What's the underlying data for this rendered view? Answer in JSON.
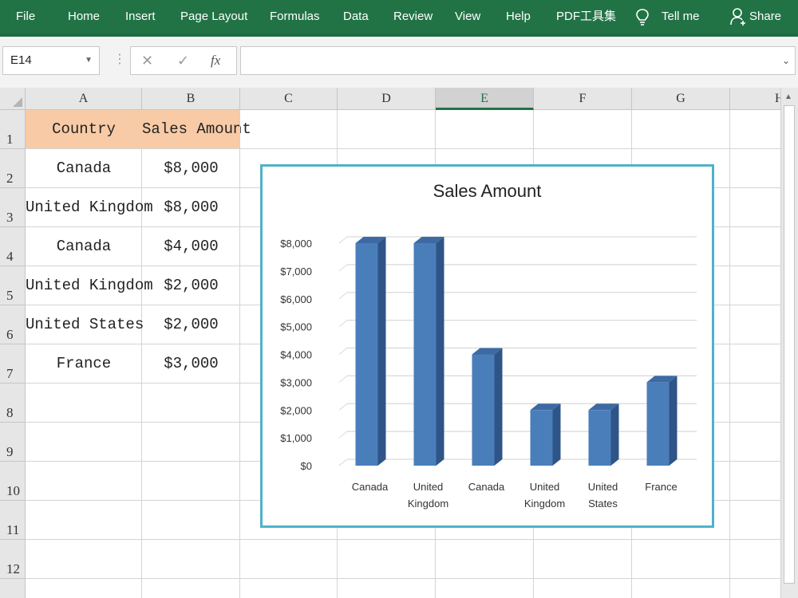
{
  "menu": {
    "items": [
      "File",
      "Home",
      "Insert",
      "Page Layout",
      "Formulas",
      "Data",
      "Review",
      "View",
      "Help",
      "PDF工具集"
    ],
    "tell_me": "Tell me",
    "share": "Share"
  },
  "formula_bar": {
    "name_box": "E14",
    "cancel": "✕",
    "enter": "✓",
    "fx": "fx",
    "content": ""
  },
  "grid": {
    "columns": [
      "A",
      "B",
      "C",
      "D",
      "E",
      "F",
      "G",
      "H"
    ],
    "selected_column": "E",
    "rows": [
      "1",
      "2",
      "3",
      "4",
      "5",
      "6",
      "7",
      "8",
      "9",
      "10",
      "11",
      "12"
    ],
    "header_row": [
      "Country",
      "Sales Amount"
    ],
    "data": [
      [
        "Canada",
        "$8,000"
      ],
      [
        "United Kingdom",
        "$8,000"
      ],
      [
        "Canada",
        "$4,000"
      ],
      [
        "United Kingdom",
        "$2,000"
      ],
      [
        "United States",
        "$2,000"
      ],
      [
        "France",
        "$3,000"
      ]
    ]
  },
  "colors": {
    "ribbon": "#217346",
    "header_fill": "#f8cba6",
    "bar": "#4a7ebb",
    "chart_border": "#4fb2cb"
  },
  "chart_data": {
    "type": "bar",
    "style": "3d-column",
    "title": "Sales Amount",
    "categories": [
      "Canada",
      "United Kingdom",
      "Canada",
      "United Kingdom",
      "United States",
      "France"
    ],
    "category_labels": [
      [
        "Canada"
      ],
      [
        "United",
        "Kingdom"
      ],
      [
        "Canada"
      ],
      [
        "United",
        "Kingdom"
      ],
      [
        "United",
        "States"
      ],
      [
        "France"
      ]
    ],
    "values": [
      8000,
      8000,
      4000,
      2000,
      2000,
      3000
    ],
    "ylim": [
      0,
      8000
    ],
    "yticks": [
      "$0",
      "$1,000",
      "$2,000",
      "$3,000",
      "$4,000",
      "$5,000",
      "$6,000",
      "$7,000",
      "$8,000"
    ],
    "grid": true,
    "legend": "none",
    "xlabel": "",
    "ylabel": ""
  }
}
